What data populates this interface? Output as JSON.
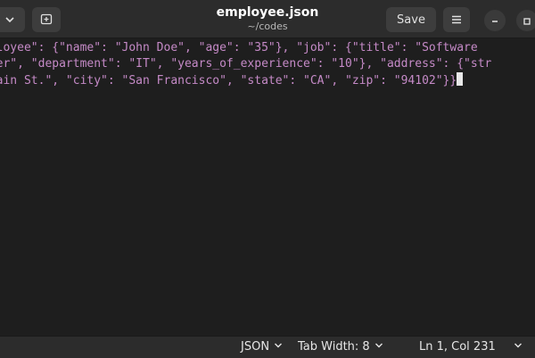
{
  "header": {
    "title": "employee.json",
    "subtitle": "~/codes",
    "save_label": "Save"
  },
  "editor": {
    "lines": [
      "mployee\": {\"name\": \"John Doe\", \"age\": \"35\"}, \"job\": {\"title\": \"Software",
      "neer\", \"department\": \"IT\", \"years_of_experience\": \"10\"}, \"address\": {\"str",
      " Main St.\", \"city\": \"San Francisco\", \"state\": \"CA\", \"zip\": \"94102\"}}"
    ],
    "text_color": "#c58ac7"
  },
  "status": {
    "language": "JSON",
    "tab_width": "Tab Width: 8",
    "position": "Ln 1, Col 231"
  },
  "icons": {
    "dropdown": "chevron-down-icon",
    "new_tab": "new-tab-icon",
    "menu": "hamburger-menu-icon",
    "minimize": "minimize-icon",
    "maximize": "maximize-icon"
  }
}
